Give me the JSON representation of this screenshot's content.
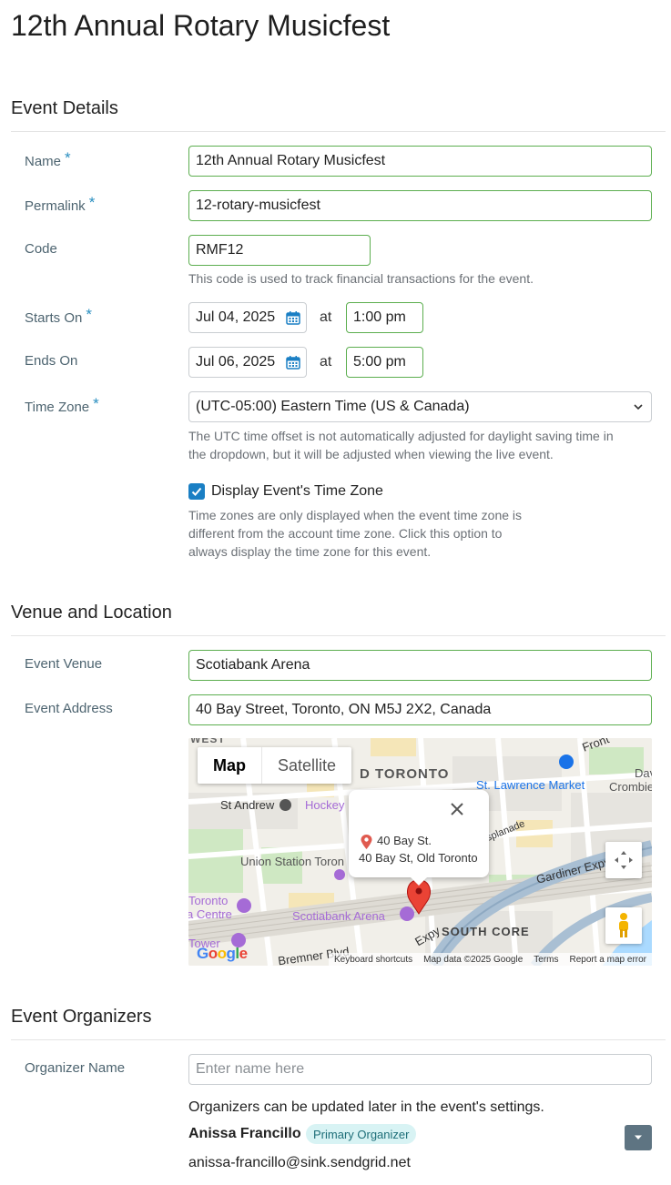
{
  "page": {
    "title": "12th Annual Rotary Musicfest"
  },
  "sections": {
    "event_details": "Event Details",
    "venue_location": "Venue and Location",
    "organizers": "Event Organizers"
  },
  "fields": {
    "name": {
      "label": "Name",
      "required": "*",
      "value": "12th Annual Rotary Musicfest"
    },
    "permalink": {
      "label": "Permalink",
      "required": "*",
      "value": "12-rotary-musicfest"
    },
    "code": {
      "label": "Code",
      "value": "RMF12",
      "help": "This code is used to track financial transactions for the event."
    },
    "starts_on": {
      "label": "Starts On",
      "required": "*",
      "date": "Jul 04, 2025",
      "at": "at",
      "time": "1:00 pm"
    },
    "ends_on": {
      "label": "Ends On",
      "date": "Jul 06, 2025",
      "at": "at",
      "time": "5:00 pm"
    },
    "time_zone": {
      "label": "Time Zone",
      "required": "*",
      "value": "(UTC-05:00) Eastern Time (US & Canada)",
      "help_line1": "The UTC time offset is not automatically adjusted for daylight saving time in",
      "help_line2": "the dropdown, but it will be adjusted when viewing the live event."
    },
    "display_tz": {
      "label": "Display Event's Time Zone",
      "checked": true,
      "help_line1": "Time zones are only displayed when the event time zone is",
      "help_line2": "different from the account time zone. Click this option to",
      "help_line3": "always display the time zone for this event."
    },
    "venue": {
      "label": "Event Venue",
      "value": "Scotiabank Arena"
    },
    "address": {
      "label": "Event Address",
      "value": "40 Bay Street, Toronto, ON M5J 2X2, Canada"
    }
  },
  "map": {
    "tabs": {
      "map": "Map",
      "satellite": "Satellite"
    },
    "labels": {
      "west": "WEST",
      "old_toronto": "D TORONTO",
      "st_andrew": "St Andrew",
      "hockey": "Hockey",
      "front": "Front",
      "st_lawrence": "St. Lawrence Market",
      "crombie": "Crombie",
      "dav": "Dav",
      "esplanade": "splanade",
      "union": "Union Station Toron",
      "gardiner": "Gardiner Expy",
      "toronto": "Toronto",
      "centre": "a Centre",
      "scotiabank": "Scotiabank Arena",
      "south_core": "SOUTH CORE",
      "tower": "Tower",
      "bremner": "Bremner Blvd",
      "expy": "Expy"
    },
    "popup": {
      "line1": "40 Bay St.",
      "line2": "40 Bay St, Old Toronto"
    },
    "footer": {
      "shortcuts": "Keyboard shortcuts",
      "data": "Map data ©2025 Google",
      "terms": "Terms",
      "report": "Report a map error"
    },
    "logo": "Google"
  },
  "organizers": {
    "label": "Organizer Name",
    "placeholder": "Enter name here",
    "help": "Organizers can be updated later in the event's settings.",
    "list": [
      {
        "name": "Anissa Francillo",
        "badge": "Primary Organizer",
        "email": "anissa-francillo@sink.sendgrid.net"
      }
    ]
  },
  "colors": {
    "accent": "#1a7fc4",
    "valid_border": "#5cae4f",
    "label": "#4d6470"
  }
}
